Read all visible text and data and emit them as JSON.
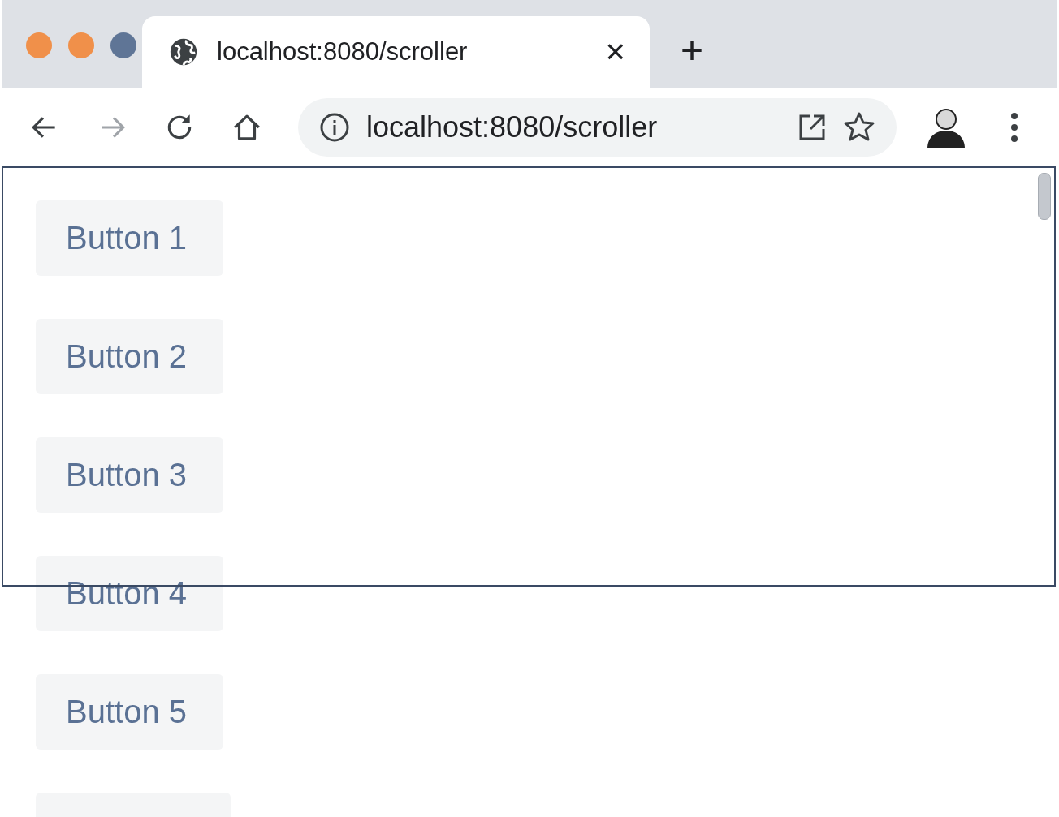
{
  "window": {
    "controls": [
      {
        "color": "#f0904a"
      },
      {
        "color": "#f0904a"
      },
      {
        "color": "#5f7596"
      }
    ]
  },
  "tab": {
    "title": "localhost:8080/scroller",
    "close": "×",
    "selected": true
  },
  "new_tab": "+",
  "toolbar": {
    "nav": [
      {
        "kind": "back",
        "disabled": false
      },
      {
        "kind": "forward",
        "disabled": true
      },
      {
        "kind": "reload",
        "disabled": false
      },
      {
        "kind": "home",
        "disabled": false
      }
    ],
    "address": "localhost:8080/scroller"
  },
  "buttons": [
    {
      "kind": "button",
      "label": "Button 1"
    },
    {
      "kind": "button",
      "label": "Button 2"
    },
    {
      "kind": "button",
      "label": "Button 3"
    },
    {
      "kind": "button",
      "label": "Button 4"
    },
    {
      "kind": "button",
      "label": "Button 5"
    },
    {
      "kind": "clipped"
    }
  ]
}
